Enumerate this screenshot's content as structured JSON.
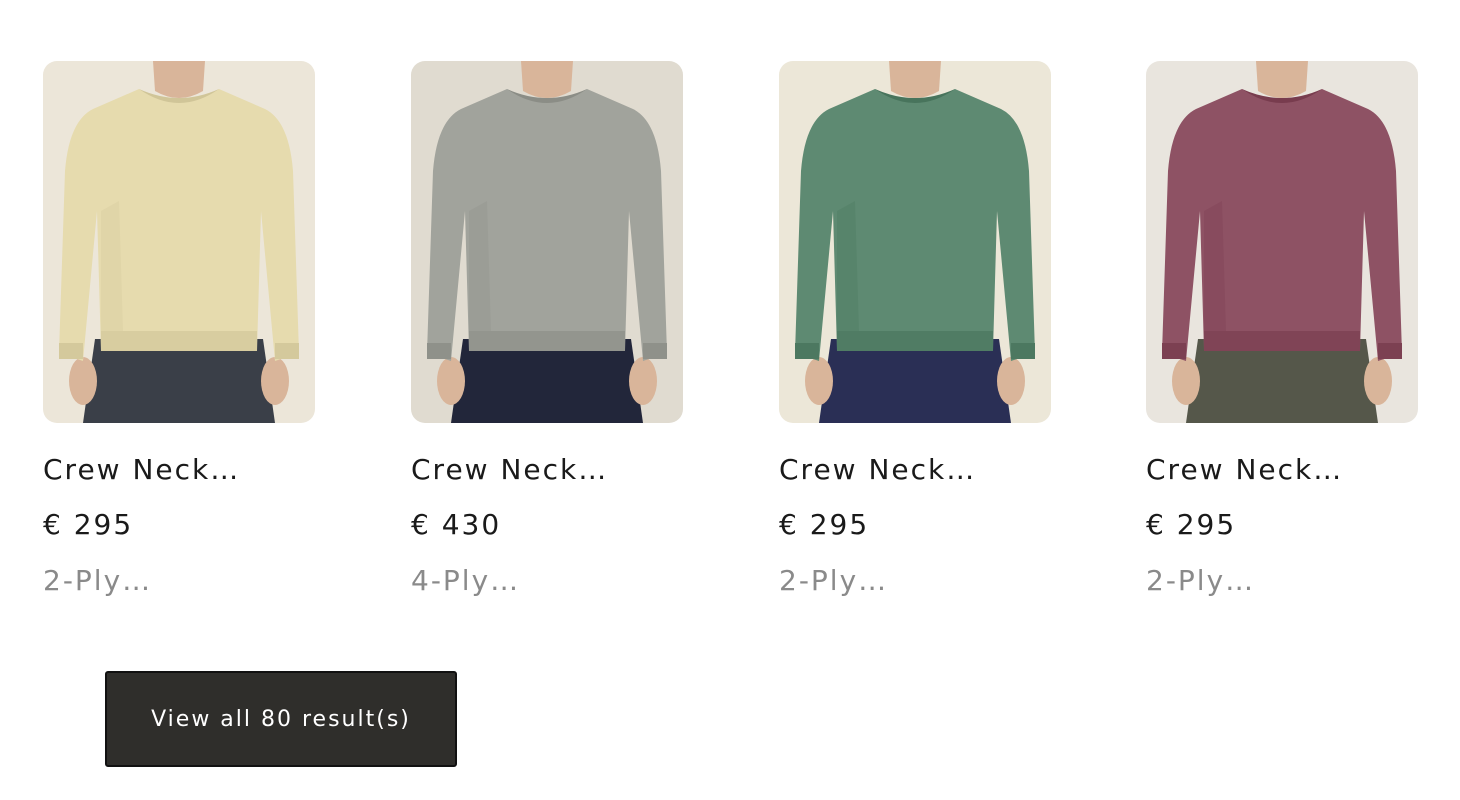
{
  "products": [
    {
      "title": "Crew Neck…",
      "price": "€ 295",
      "subtitle": "2-Ply…",
      "image_icon": "product-photo-icon",
      "sweater_color": "#e6dbae",
      "pants_color": "#3a3f48",
      "background_color": "#ece6d9"
    },
    {
      "title": "Crew Neck…",
      "price": "€ 430",
      "subtitle": "4-Ply…",
      "image_icon": "product-photo-icon",
      "sweater_color": "#a1a39c",
      "pants_color": "#22263a",
      "background_color": "#e0dbd0"
    },
    {
      "title": "Crew Neck…",
      "price": "€ 295",
      "subtitle": "2-Ply…",
      "image_icon": "product-photo-icon",
      "sweater_color": "#5e8a72",
      "pants_color": "#2a2f55",
      "background_color": "#ece7d8"
    },
    {
      "title": "Crew Neck…",
      "price": "€ 295",
      "subtitle": "2-Ply…",
      "image_icon": "product-photo-icon",
      "sweater_color": "#8e5264",
      "pants_color": "#55574a",
      "background_color": "#e9e5de"
    }
  ],
  "view_all": {
    "label": "View all 80 result(s)"
  }
}
